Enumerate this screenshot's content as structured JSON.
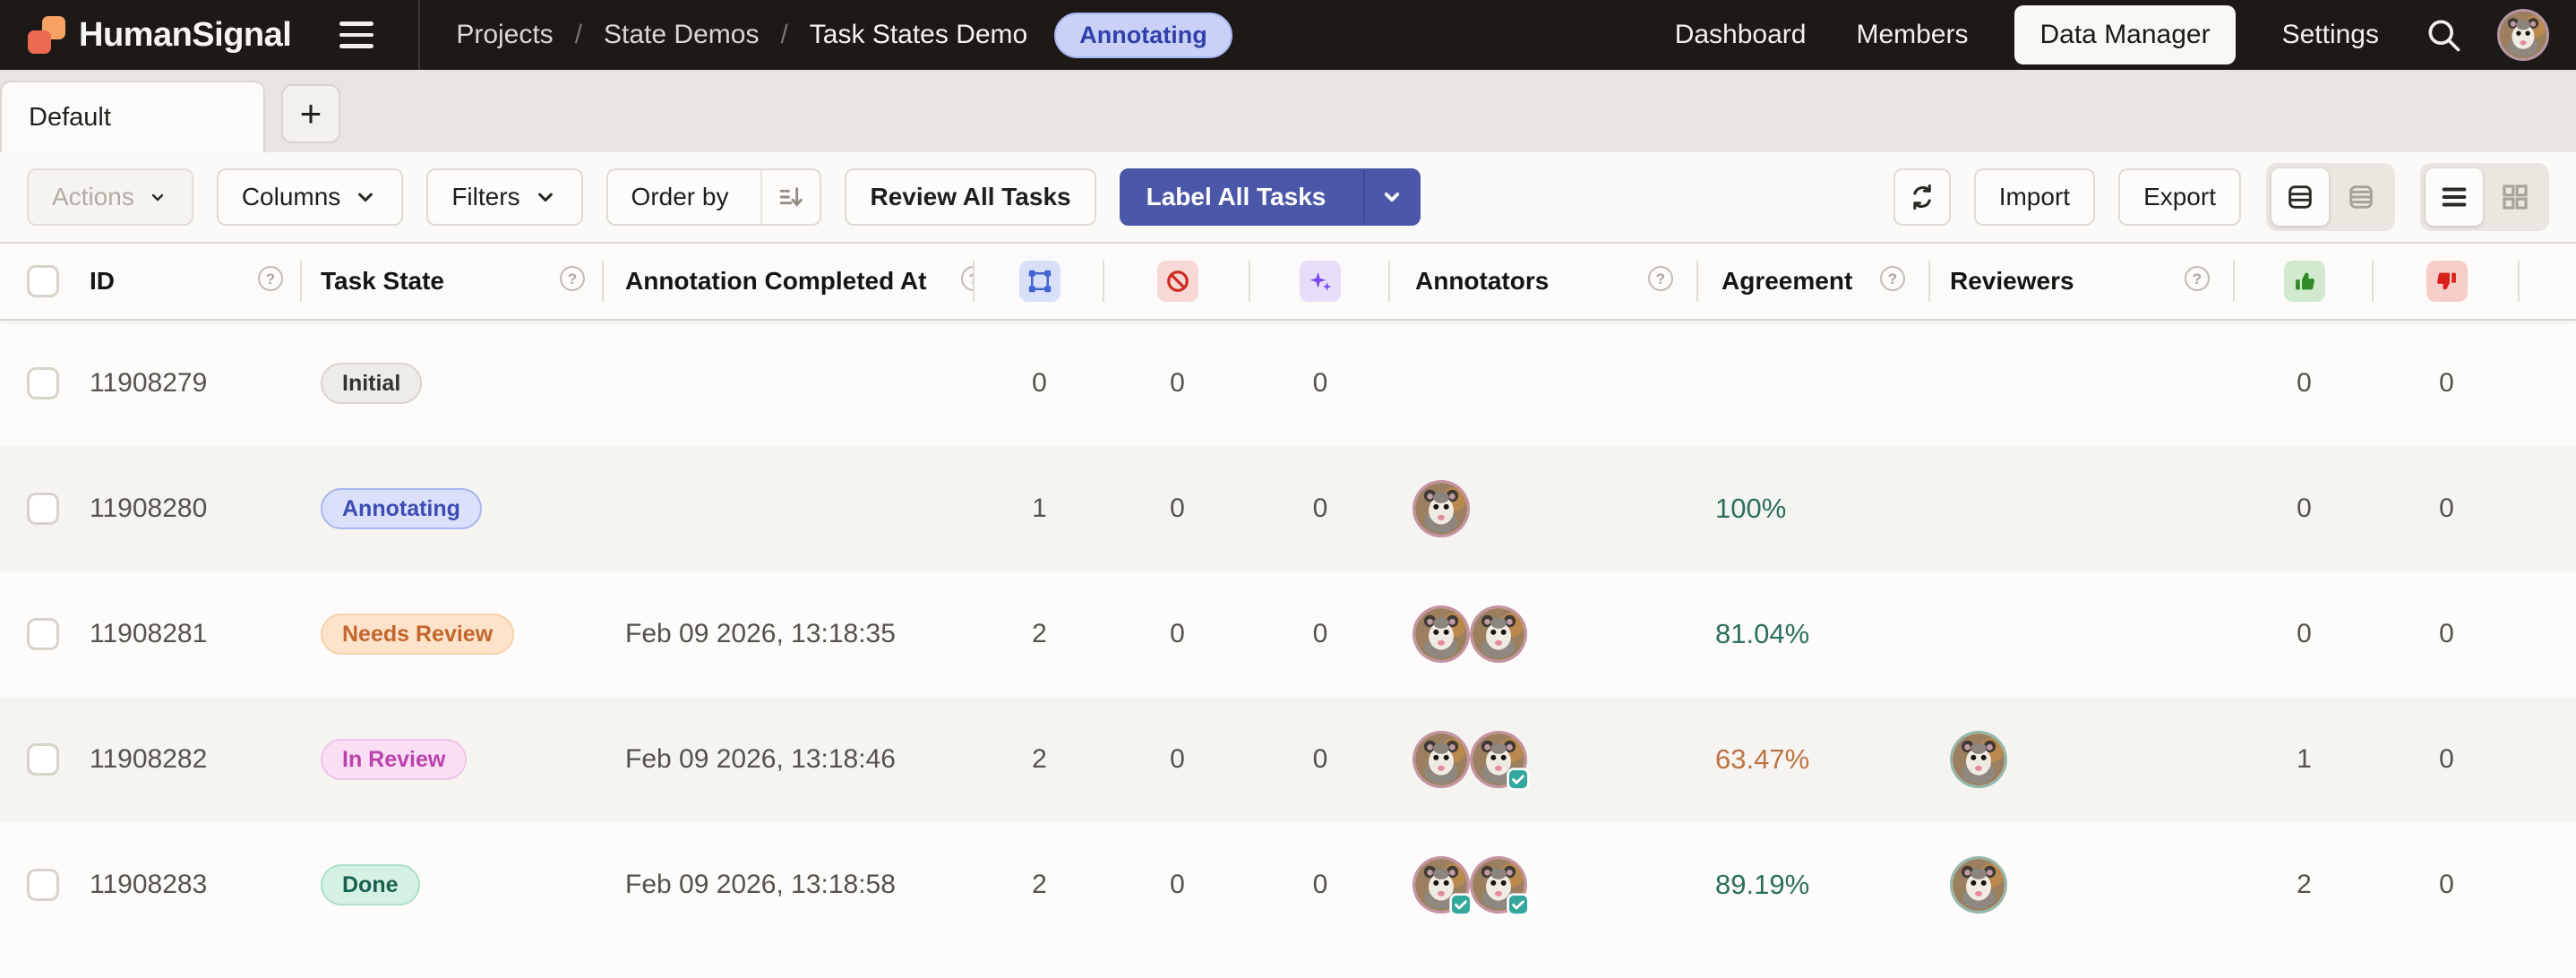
{
  "topbar": {
    "brand": "HumanSignal",
    "breadcrumbs": [
      "Projects",
      "State Demos",
      "Task States Demo"
    ],
    "breadcrumb_separator": "/",
    "project_status_badge": "Annotating",
    "nav": [
      {
        "label": "Dashboard",
        "active": false
      },
      {
        "label": "Members",
        "active": false
      },
      {
        "label": "Data Manager",
        "active": true
      },
      {
        "label": "Settings",
        "active": false
      }
    ]
  },
  "tabs": {
    "items": [
      {
        "label": "Default",
        "active": true
      }
    ],
    "add_button_label": "+"
  },
  "toolbar": {
    "actions_label": "Actions",
    "columns_label": "Columns",
    "filters_label": "Filters",
    "order_by_label": "Order by",
    "review_all_label": "Review All Tasks",
    "label_all_label": "Label All Tasks",
    "import_label": "Import",
    "export_label": "Export"
  },
  "table": {
    "columns": {
      "id": "ID",
      "task_state": "Task State",
      "completed_at": "Annotation Completed At",
      "annotators": "Annotators",
      "agreement": "Agreement",
      "reviewers": "Reviewers"
    },
    "icon_columns": [
      "annotations",
      "cancelled-annotations",
      "predictions",
      "reviews-accepted",
      "reviews-rejected"
    ],
    "rows": [
      {
        "id": "11908279",
        "state": "Initial",
        "state_type": "initial",
        "completed_at": "",
        "annotations": "0",
        "cancelled": "0",
        "predictions": "0",
        "annotators": [],
        "agreement": "",
        "agreement_level": "",
        "reviewers": [],
        "accepted": "0",
        "rejected": "0"
      },
      {
        "id": "11908280",
        "state": "Annotating",
        "state_type": "annotating",
        "completed_at": "",
        "annotations": "1",
        "cancelled": "0",
        "predictions": "0",
        "annotators": [
          {
            "checked": false
          }
        ],
        "agreement": "100%",
        "agreement_level": "good",
        "reviewers": [],
        "accepted": "0",
        "rejected": "0"
      },
      {
        "id": "11908281",
        "state": "Needs Review",
        "state_type": "needs-review",
        "completed_at": "Feb 09 2026, 13:18:35",
        "annotations": "2",
        "cancelled": "0",
        "predictions": "0",
        "annotators": [
          {
            "checked": false
          },
          {
            "checked": false
          }
        ],
        "agreement": "81.04%",
        "agreement_level": "good",
        "reviewers": [],
        "accepted": "0",
        "rejected": "0"
      },
      {
        "id": "11908282",
        "state": "In Review",
        "state_type": "in-review",
        "completed_at": "Feb 09 2026, 13:18:46",
        "annotations": "2",
        "cancelled": "0",
        "predictions": "0",
        "annotators": [
          {
            "checked": false
          },
          {
            "checked": true
          }
        ],
        "agreement": "63.47%",
        "agreement_level": "warn",
        "reviewers": [
          {}
        ],
        "accepted": "1",
        "rejected": "0"
      },
      {
        "id": "11908283",
        "state": "Done",
        "state_type": "done",
        "completed_at": "Feb 09 2026, 13:18:58",
        "annotations": "2",
        "cancelled": "0",
        "predictions": "0",
        "annotators": [
          {
            "checked": true
          },
          {
            "checked": true
          }
        ],
        "agreement": "89.19%",
        "agreement_level": "good",
        "reviewers": [
          {}
        ],
        "accepted": "2",
        "rejected": "0"
      }
    ]
  },
  "colors": {
    "accent": "#4b58a9",
    "topbar-bg": "#1c1917",
    "agreement-good": "#2c6f60",
    "agreement-warn": "#bf7342",
    "annotations-icon": "#4464d2",
    "cancelled-icon": "#cd2d22",
    "predictions-icon": "#7c49ef",
    "accepted-icon": "#2e8a26",
    "rejected-icon": "#d8211b",
    "check-badge": "#35a89d"
  }
}
